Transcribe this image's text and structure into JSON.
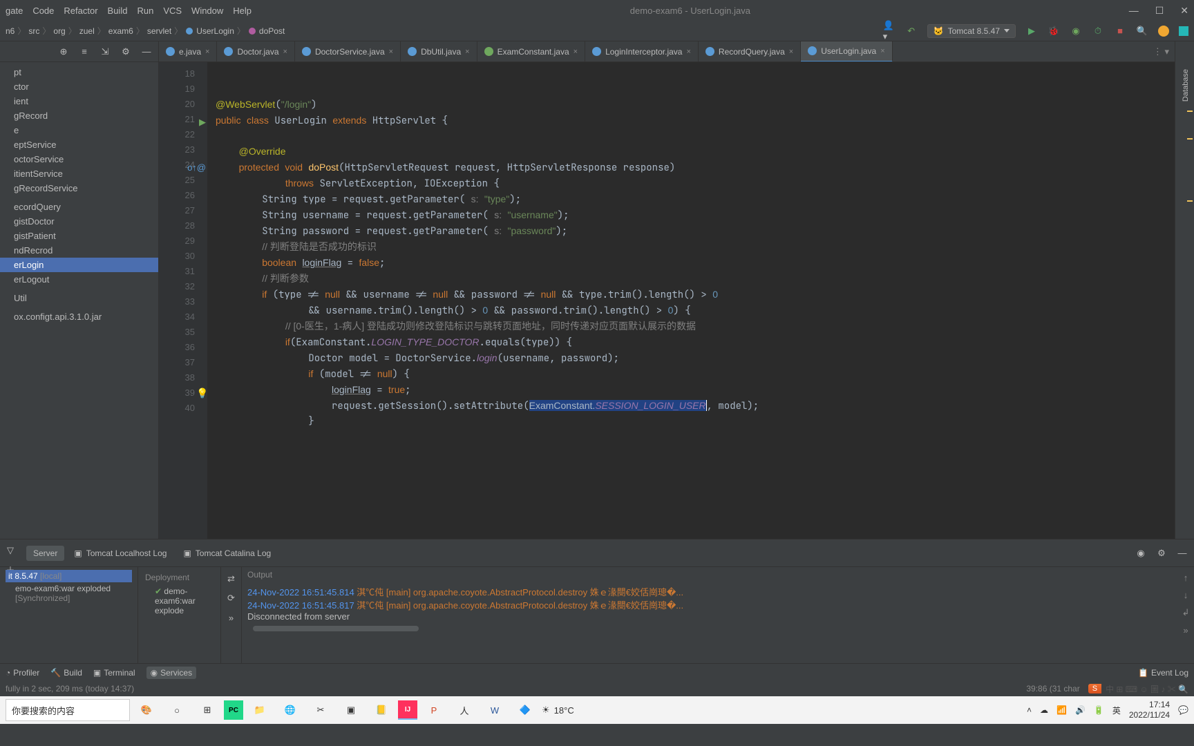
{
  "menubar": [
    "gate",
    "Code",
    "Refactor",
    "Build",
    "Run",
    "VCS",
    "Window",
    "Help"
  ],
  "window_title": "demo-exam6 - UserLogin.java",
  "breadcrumb": [
    "n6",
    "src",
    "org",
    "zuel",
    "exam6",
    "servlet",
    "UserLogin",
    "doPost"
  ],
  "run_config": "Tomcat 8.5.47",
  "tree_items": [
    "pt",
    "ctor",
    "ient",
    "gRecord",
    "e",
    "eptService",
    "octorService",
    "itientService",
    "gRecordService",
    "",
    "ecordQuery",
    "gistDoctor",
    "gistPatient",
    "ndRecrod",
    "erLogin",
    "erLogout",
    "",
    "Util",
    "",
    "ox.configt.api.3.1.0.jar"
  ],
  "tree_selected_index": 14,
  "tabs": [
    {
      "label": "e.java",
      "type": "c"
    },
    {
      "label": "Doctor.java",
      "type": "c"
    },
    {
      "label": "DoctorService.java",
      "type": "c"
    },
    {
      "label": "DbUtil.java",
      "type": "c"
    },
    {
      "label": "ExamConstant.java",
      "type": "i"
    },
    {
      "label": "LoginInterceptor.java",
      "type": "c"
    },
    {
      "label": "RecordQuery.java",
      "type": "c"
    },
    {
      "label": "UserLogin.java",
      "type": "c",
      "active": true
    }
  ],
  "warnings_count": "3",
  "line_numbers": [
    "18",
    "19",
    "20",
    "21",
    "22",
    "23",
    "24",
    "25",
    "26",
    "27",
    "28",
    "29",
    "30",
    "31",
    "32",
    "33",
    "34",
    "35",
    "36",
    "37",
    "38",
    "39",
    "40"
  ],
  "code": {
    "l20_ann": "@WebServlet",
    "l20_p1": "(",
    "l20_str": "\"/login\"",
    "l20_p2": ")",
    "l21": "public class UserLogin extends HttpServlet {",
    "l23": "@Override",
    "l24": "protected void doPost(HttpServletRequest request, HttpServletResponse response)",
    "l25": "throws ServletException, IOException {",
    "l26": "String type = request.getParameter( s: \"type\");",
    "l27": "String username = request.getParameter( s: \"username\");",
    "l28": "String password = request.getParameter( s: \"password\");",
    "l29": "// 判断登陆是否成功的标识",
    "l30": "boolean loginFlag = false;",
    "l31": "// 判断参数",
    "l32": "if (type != null && username != null && password != null && type.trim().length() > 0",
    "l33": "&& username.trim().length() > 0 && password.trim().length() > 0) {",
    "l34": "// [0-医生，1-病人] 登陆成功则修改登陆标识与跳转页面地址，同时传递对应页面默认展示的数据",
    "l35": "if(ExamConstant.LOGIN_TYPE_DOCTOR.equals(type)) {",
    "l36": "Doctor model = DoctorService.login(username, password);",
    "l37": "if (model != null) {",
    "l38": "loginFlag = true;",
    "l39_pre": "request.getSession().setAttribute(",
    "l39_sel": "ExamConstant.SESSION_LOGIN_USER",
    "l39_post": ", model);",
    "l40": "}"
  },
  "services": {
    "name": "it 8.5.47",
    "status": "[local]",
    "artifact": "emo-exam6:war exploded",
    "sync": "[Synchronized]"
  },
  "run_tabs": [
    "Server",
    "Tomcat Localhost Log",
    "Tomcat Catalina Log"
  ],
  "deployment": {
    "header": "Deployment",
    "item": "demo-exam6:war explode"
  },
  "output": {
    "header": "Output",
    "lines": [
      {
        "ts": "24-Nov-2022 16:51:45.814",
        "rest": " 淇℃伅 [main] org.apache.coyote.AbstractProtocol.destroy 姝ｅ湪閿€姣佸崗璁�..."
      },
      {
        "ts": "24-Nov-2022 16:51:45.817",
        "rest": " 淇℃伅 [main] org.apache.coyote.AbstractProtocol.destroy 姝ｅ湪閿€姣佸崗璁�..."
      }
    ],
    "disconnect": "Disconnected from server"
  },
  "bottom_bar": {
    "profiler": "Profiler",
    "build": "Build",
    "terminal": "Terminal",
    "services": "Services",
    "event_log": "Event Log"
  },
  "statusbar": {
    "left": "fully in 2 sec, 209 ms (today 14:37)",
    "right": "39:86 (31 char"
  },
  "taskbar": {
    "search": "你要搜索的内容",
    "weather": "18°C",
    "time": "17:14",
    "date": "2022/11/24"
  }
}
